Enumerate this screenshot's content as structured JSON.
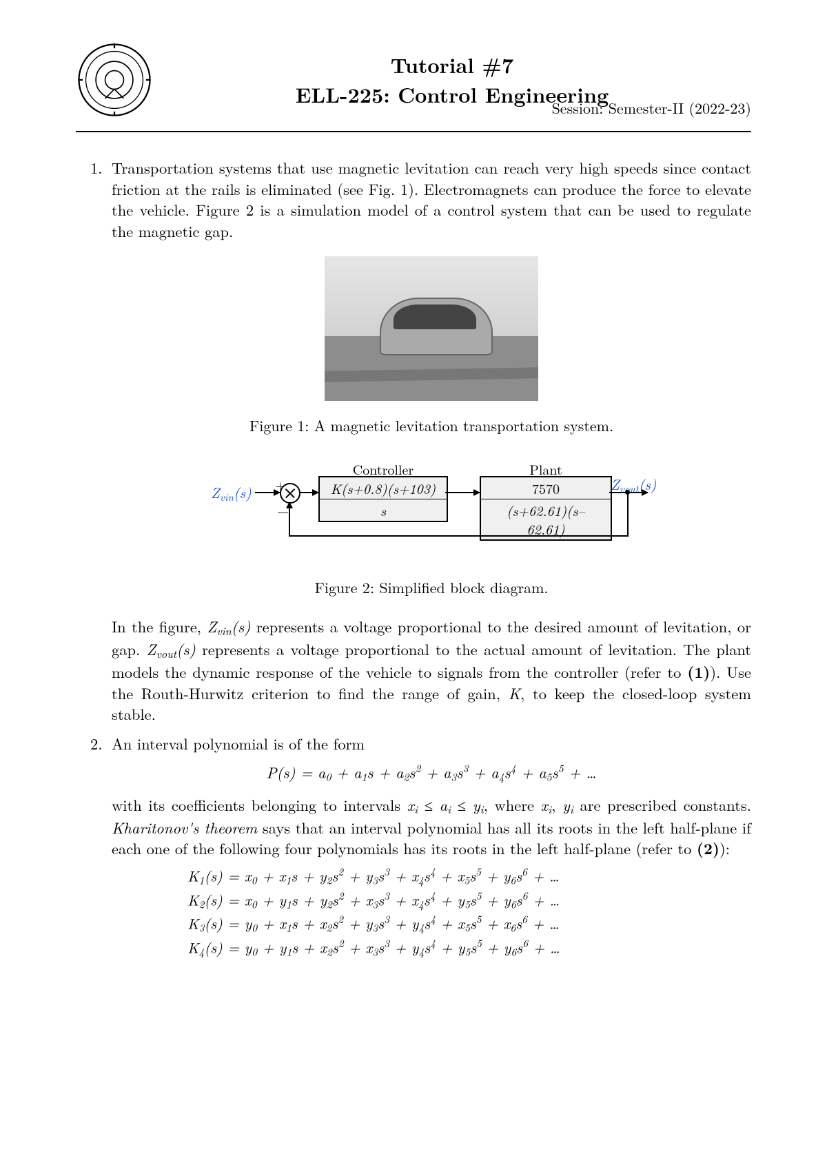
{
  "header": {
    "title_line1": "Tutorial #7",
    "title_line2": "ELL-225: Control Engineering",
    "session": "Session: Semester-II (2022-23)"
  },
  "q1": {
    "intro": "Transportation systems that use magnetic levitation can reach very high speeds since contact friction at the rails is eliminated (see Fig. 1). Electromagnets can produce the force to elevate the vehicle. Figure 2 is a simulation model of a control system that can be used to regulate the magnetic gap.",
    "fig1_caption": "Figure 1: A magnetic levitation transportation system.",
    "diagram": {
      "input_label": "Z",
      "input_sub": "vin",
      "input_arg": "(s)",
      "output_label": "Z",
      "output_sub": "vout",
      "output_arg": "(s)",
      "plus": "+",
      "minus": "−",
      "controller_label": "Controller",
      "controller_num": "K(s+0.8)(s+103)",
      "controller_den": "s",
      "plant_label": "Plant",
      "plant_num": "7570",
      "plant_den": "(s+62.61)(s–62.61)"
    },
    "fig2_caption": "Figure 2: Simplified block diagram.",
    "para2_a": "In the figure, ",
    "para2_b": " represents a voltage proportional to the desired amount of levitation, or gap. ",
    "para2_c": " represents a voltage proportional to the actual amount of levitation. The plant models the dynamic response of the vehicle to signals from the controller (refer to ",
    "ref1": "(1)",
    "para2_d": "). Use the Routh-Hurwitz criterion to find the range of gain, ",
    "para2_e": ", to keep the closed-loop system stable.",
    "Zvin": "Z",
    "Zvin_sub": "vin",
    "Zvin_arg": "(s)",
    "Zvout": "Z",
    "Zvout_sub": "vout",
    "Zvout_arg": "(s)",
    "K": "K"
  },
  "q2": {
    "lead": "An interval polynomial is of the form",
    "poly": "P(s) = a₀ + a₁s + a₂s² + a₃s³ + a₄s⁴ + a₅s⁵ + …",
    "mid_a": "with its coefficients belonging to intervals ",
    "ineq": "xᵢ ≤ aᵢ ≤ yᵢ",
    "mid_b": ", where ",
    "vars": "xᵢ, yᵢ",
    "mid_c": " are prescribed constants. ",
    "theorem": "Kharitonov's theorem",
    "mid_d": " says that an interval polynomial has all its roots in the left half-plane if each one of the following four polynomials has its roots in the left half-plane (refer to ",
    "ref2": "(2)",
    "mid_e": "):",
    "K1": "K₁(s) = x₀ + x₁s + y₂s² + y₃s³ + x₄s⁴ + x₅s⁵ + y₆s⁶ + …",
    "K2": "K₂(s) = x₀ + y₁s + y₂s² + x₃s³ + x₄s⁴ + y₅s⁵ + y₆s⁶ + …",
    "K3": "K₃(s) = y₀ + x₁s + x₂s² + y₃s³ + y₄s⁴ + x₅s⁵ + x₆s⁶ + …",
    "K4": "K₄(s) = y₀ + y₁s + x₂s² + x₃s³ + y₄s⁴ + y₅s⁵ + y₆s⁶ + …"
  }
}
